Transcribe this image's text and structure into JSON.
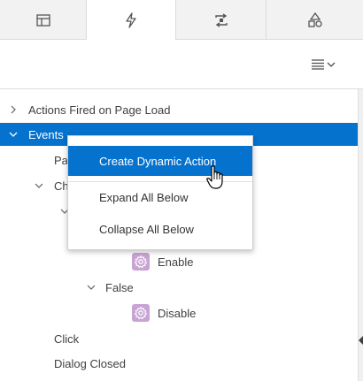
{
  "tabs": [
    {
      "icon": "table-icon",
      "active": false
    },
    {
      "icon": "lightning-icon",
      "active": true
    },
    {
      "icon": "shared-components-icon",
      "active": false
    },
    {
      "icon": "shapes-icon",
      "active": false
    }
  ],
  "toolbar": {
    "menu_icon": "hamburger-menu-icon"
  },
  "tree": {
    "actions_on_load": "Actions Fired on Page Load",
    "events": "Events",
    "page_partial": "Pa",
    "change_partial": "Ch",
    "enable": "Enable",
    "false_node": "False",
    "disable": "Disable",
    "click": "Click",
    "dialog_closed": "Dialog Closed"
  },
  "context_menu": {
    "create": "Create Dynamic Action",
    "expand": "Expand All Below",
    "collapse": "Collapse All Below"
  },
  "colors": {
    "accent": "#0572ce",
    "gear": "#c8a3d4"
  }
}
